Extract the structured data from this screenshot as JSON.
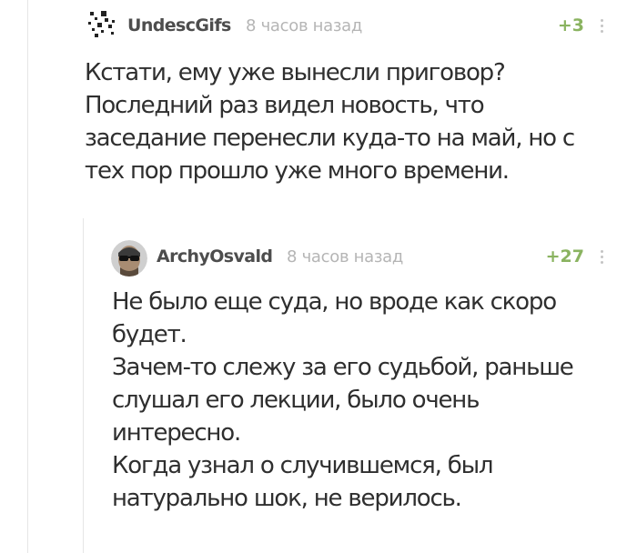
{
  "comments": [
    {
      "username": "UndescGifs",
      "time": "8 часов назад",
      "rating": "+3",
      "avatar_icon": "pixel-pattern-avatar",
      "text_lines": [
        "Кстати, ему уже вынесли приговор?",
        "Последний раз видел новость, что",
        "заседание перенесли куда-то на май, но с",
        "тех пор прошло уже много времени."
      ]
    },
    {
      "username": "ArchyOsvald",
      "time": "8 часов назад",
      "rating": "+27",
      "avatar_icon": "man-with-sunglasses-avatar",
      "text_lines": [
        "Не было еще суда, но вроде как скоро",
        "будет.",
        "Зачем-то слежу за его судьбой, раньше",
        "слушал его лекции, было очень",
        "интересно.",
        "Когда узнал о случившемся, был",
        "натурально шок, не верилось."
      ]
    }
  ],
  "colors": {
    "rating_green": "#8ab360",
    "username_gray": "#4d4d4d",
    "timestamp_gray": "#b5b5b5",
    "thread_line": "#e6e6e6",
    "text": "#2f2f2f"
  }
}
